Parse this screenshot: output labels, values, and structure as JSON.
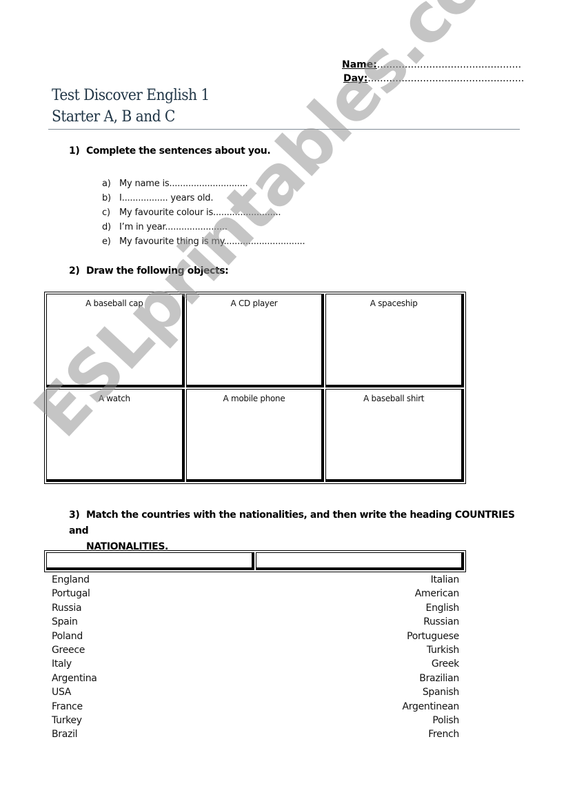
{
  "header": {
    "name_label": "Name:",
    "name_blank": "...............................................",
    "day_label": "Day:",
    "day_blank": "...................................................",
    "title_line1": "Test Discover English 1",
    "title_line2": "Starter A, B and C"
  },
  "question1": {
    "number": "1)",
    "text": "Complete the sentences about you.",
    "items": [
      {
        "letter": "a)",
        "text": "My name is............................."
      },
      {
        "letter": "b)",
        "text": "I................. years old."
      },
      {
        "letter": "c)",
        "text": "My favourite colour is........................."
      },
      {
        "letter": "d)",
        "text": "I’m in year......................."
      },
      {
        "letter": "e)",
        "text": "My favourite thing is my.............................."
      }
    ]
  },
  "question2": {
    "number": "2)",
    "text": "Draw the following objects:",
    "cells": [
      "A baseball cap",
      "A CD player",
      "A spaceship",
      "A watch",
      "A mobile phone",
      "A baseball shirt"
    ]
  },
  "question3": {
    "number": "3)",
    "text_line1": "Match the countries with the nationalities, and then write the heading COUNTRIES and",
    "text_line2": "NATIONALITIES.",
    "heading_cells": [
      "",
      ""
    ],
    "countries": [
      "England",
      "Portugal",
      "Russia",
      "Spain",
      "Poland",
      "Greece",
      "Italy",
      "Argentina",
      "USA",
      "France",
      "Turkey",
      "Brazil"
    ],
    "nationalities": [
      "Italian",
      "American",
      "English",
      "Russian",
      "Portuguese",
      "Turkish",
      "Greek",
      "Brazilian",
      "Spanish",
      "Argentinean",
      "Polish",
      "French"
    ]
  },
  "watermark": {
    "text": "ESLprintables.com"
  },
  "colors": {
    "title": "#1f3445",
    "rule": "#7f8a94",
    "watermark": "#969696"
  }
}
